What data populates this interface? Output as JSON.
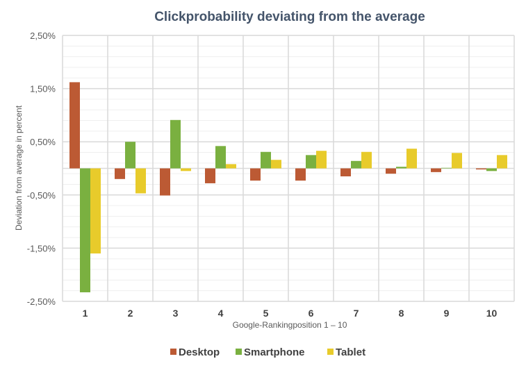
{
  "chart_data": {
    "type": "bar",
    "title": "Clickprobability deviating from the average",
    "xlabel": "Google-Rankingposition  1 – 10",
    "ylabel": "Deviation from average in percent",
    "categories": [
      "1",
      "2",
      "3",
      "4",
      "5",
      "6",
      "7",
      "8",
      "9",
      "10"
    ],
    "ylim": [
      -2.5,
      2.5
    ],
    "yticks": [
      2.5,
      1.5,
      0.5,
      -0.5,
      -1.5,
      -2.5
    ],
    "ytick_labels": [
      "2,50%",
      "1,50%",
      "0,50%",
      "-0,50%",
      "-1,50%",
      "-2,50%"
    ],
    "minor_grid_step": 0.2,
    "grid": true,
    "legend_position": "bottom",
    "series": [
      {
        "name": "Desktop",
        "color": "#bc5a34",
        "values": [
          1.62,
          -0.2,
          -0.51,
          -0.28,
          -0.23,
          -0.23,
          -0.15,
          -0.1,
          -0.07,
          -0.02
        ]
      },
      {
        "name": "Smartphone",
        "color": "#7ab040",
        "values": [
          -2.33,
          0.5,
          0.91,
          0.42,
          0.31,
          0.25,
          0.14,
          0.03,
          0.01,
          -0.05
        ]
      },
      {
        "name": "Tablet",
        "color": "#e8cb2b",
        "values": [
          -1.6,
          -0.47,
          -0.05,
          0.08,
          0.16,
          0.33,
          0.31,
          0.37,
          0.29,
          0.25
        ]
      }
    ]
  }
}
